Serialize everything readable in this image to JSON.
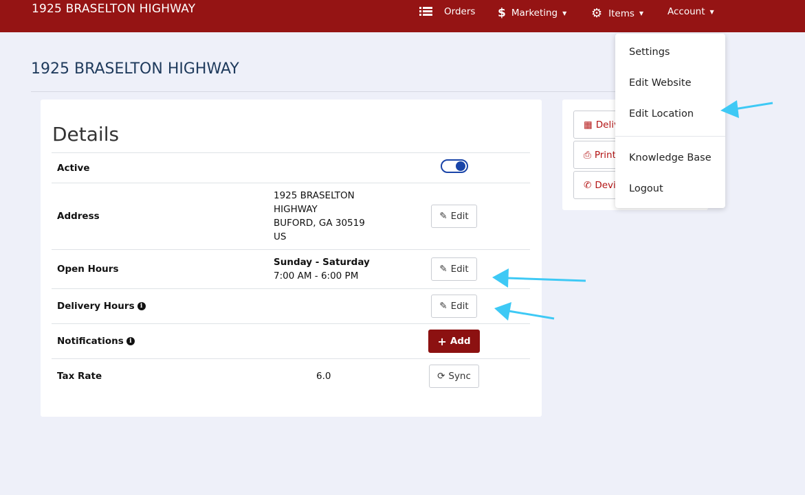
{
  "navbar": {
    "brand": "1925 BRASELTON HIGHWAY",
    "orders": "Orders",
    "marketing": "Marketing",
    "items": "Items",
    "account": "Account",
    "caret": "▼"
  },
  "page": {
    "title": "1925 BRASELTON HIGHWAY"
  },
  "details": {
    "title": "Details",
    "rows": {
      "active": {
        "label": "Active",
        "enabled": true
      },
      "address": {
        "label": "Address",
        "lines": [
          "1925 BRASELTON",
          "HIGHWAY",
          "BUFORD, GA 30519",
          "US"
        ],
        "button": "Edit"
      },
      "open_hours": {
        "label": "Open Hours",
        "days": "Sunday - Saturday",
        "hours": "7:00 AM - 6:00 PM",
        "button": "Edit"
      },
      "delivery_hours": {
        "label": "Delivery Hours",
        "button": "Edit"
      },
      "notifications": {
        "label": "Notifications",
        "button": "Add"
      },
      "tax_rate": {
        "label": "Tax Rate",
        "value": "6.0",
        "button": "Sync"
      }
    }
  },
  "side": {
    "buttons": [
      "Deliv",
      "Print",
      "Devic"
    ]
  },
  "account_menu": {
    "items": [
      "Settings",
      "Edit Website",
      "Edit Location",
      "Knowledge Base",
      "Logout"
    ]
  },
  "colors": {
    "navbar": "#951414",
    "add_button": "#8c1111",
    "toggle": "#1944a8",
    "annotation_arrow": "#3ec9f5"
  }
}
